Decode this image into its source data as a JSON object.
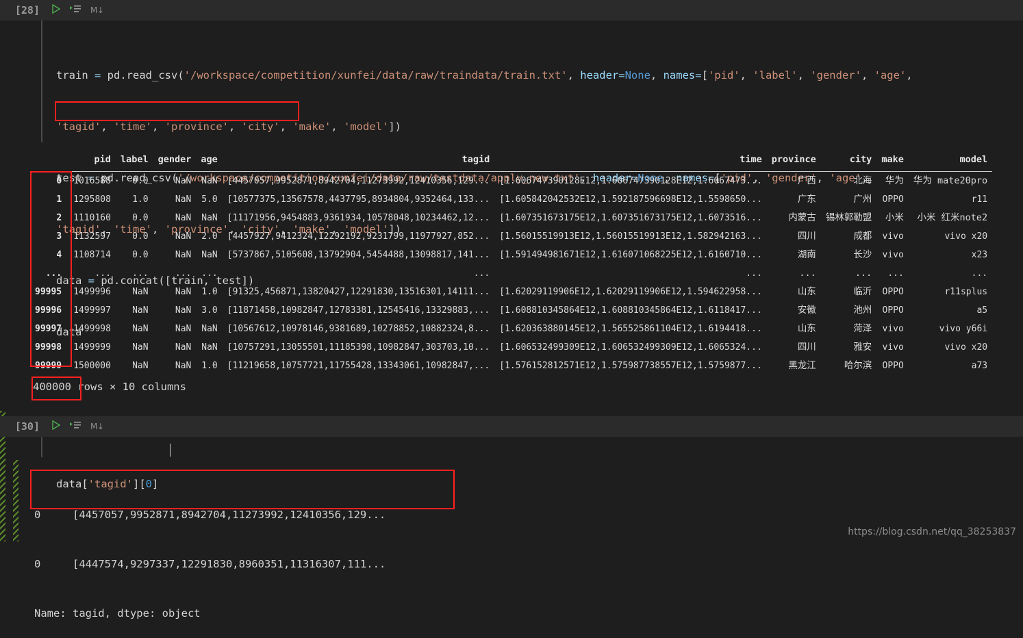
{
  "cell1": {
    "exec_count": "[28]",
    "icons": {
      "run": "play-icon",
      "run_all": "run-all-icon",
      "markdown": "M↓"
    },
    "code_lines": [
      [
        {
          "t": "train ",
          "c": "plain"
        },
        {
          "t": "= ",
          "c": "op"
        },
        {
          "t": "pd.read_csv(",
          "c": "plain"
        },
        {
          "t": "'/workspace/competition/xunfei/data/raw/traindata/train.txt'",
          "c": "str"
        },
        {
          "t": ", ",
          "c": "plain"
        },
        {
          "t": "header",
          "c": "param"
        },
        {
          "t": "=",
          "c": "op"
        },
        {
          "t": "None",
          "c": "kw"
        },
        {
          "t": ", ",
          "c": "plain"
        },
        {
          "t": "names",
          "c": "param"
        },
        {
          "t": "=",
          "c": "op"
        },
        {
          "t": "[",
          "c": "plain"
        },
        {
          "t": "'pid'",
          "c": "str"
        },
        {
          "t": ", ",
          "c": "plain"
        },
        {
          "t": "'label'",
          "c": "str"
        },
        {
          "t": ", ",
          "c": "plain"
        },
        {
          "t": "'gender'",
          "c": "str"
        },
        {
          "t": ", ",
          "c": "plain"
        },
        {
          "t": "'age'",
          "c": "str"
        },
        {
          "t": ",",
          "c": "plain"
        }
      ],
      [
        {
          "t": "'tagid'",
          "c": "str"
        },
        {
          "t": ", ",
          "c": "plain"
        },
        {
          "t": "'time'",
          "c": "str"
        },
        {
          "t": ", ",
          "c": "plain"
        },
        {
          "t": "'province'",
          "c": "str"
        },
        {
          "t": ", ",
          "c": "plain"
        },
        {
          "t": "'city'",
          "c": "str"
        },
        {
          "t": ", ",
          "c": "plain"
        },
        {
          "t": "'make'",
          "c": "str"
        },
        {
          "t": ", ",
          "c": "plain"
        },
        {
          "t": "'model'",
          "c": "str"
        },
        {
          "t": "])",
          "c": "plain"
        }
      ],
      [
        {
          "t": "test ",
          "c": "plain"
        },
        {
          "t": "= ",
          "c": "op"
        },
        {
          "t": "pd.read_csv(",
          "c": "plain"
        },
        {
          "t": "'/workspace/competition/xunfei/data/raw/testdata/apply_new.txt'",
          "c": "str"
        },
        {
          "t": ", ",
          "c": "plain"
        },
        {
          "t": "header",
          "c": "param"
        },
        {
          "t": "=",
          "c": "op"
        },
        {
          "t": "None",
          "c": "kw"
        },
        {
          "t": ", ",
          "c": "plain"
        },
        {
          "t": "names",
          "c": "param"
        },
        {
          "t": "=",
          "c": "op"
        },
        {
          "t": "[",
          "c": "plain"
        },
        {
          "t": "'pid'",
          "c": "str"
        },
        {
          "t": ", ",
          "c": "plain"
        },
        {
          "t": "'gender'",
          "c": "str"
        },
        {
          "t": ", ",
          "c": "plain"
        },
        {
          "t": "'age'",
          "c": "str"
        },
        {
          "t": ",",
          "c": "plain"
        }
      ],
      [
        {
          "t": "'tagid'",
          "c": "str"
        },
        {
          "t": ", ",
          "c": "plain"
        },
        {
          "t": "'time'",
          "c": "str"
        },
        {
          "t": ", ",
          "c": "plain"
        },
        {
          "t": "'province'",
          "c": "str"
        },
        {
          "t": ", ",
          "c": "plain"
        },
        {
          "t": "'city'",
          "c": "str"
        },
        {
          "t": ", ",
          "c": "plain"
        },
        {
          "t": "'make'",
          "c": "str"
        },
        {
          "t": ", ",
          "c": "plain"
        },
        {
          "t": "'model'",
          "c": "str"
        },
        {
          "t": "])",
          "c": "plain"
        }
      ],
      [
        {
          "t": "data ",
          "c": "plain"
        },
        {
          "t": "= ",
          "c": "op"
        },
        {
          "t": "pd.concat([train, test])",
          "c": "plain"
        }
      ],
      [
        {
          "t": "data",
          "c": "plain"
        }
      ]
    ]
  },
  "dataframe": {
    "columns": [
      "pid",
      "label",
      "gender",
      "age",
      "tagid",
      "time",
      "province",
      "city",
      "make",
      "model"
    ],
    "index_header": "",
    "rows": [
      {
        "index": "0",
        "pid": "1016588",
        "label": "0.0",
        "gender": "NaN",
        "age": "NaN",
        "tagid": "[4457057,9952871,8942704,11273992,12410356,129...",
        "time": "[1.606747390128E12,1.606747390128E12,1.6067473...",
        "province": "广西",
        "city": "北海",
        "make": "华为",
        "model": "华为 mate20pro"
      },
      {
        "index": "1",
        "pid": "1295808",
        "label": "1.0",
        "gender": "NaN",
        "age": "5.0",
        "tagid": "[10577375,13567578,4437795,8934804,9352464,133...",
        "time": "[1.605842042532E12,1.592187596698E12,1.5598650...",
        "province": "广东",
        "city": "广州",
        "make": "OPPO",
        "model": "r11"
      },
      {
        "index": "2",
        "pid": "1110160",
        "label": "0.0",
        "gender": "NaN",
        "age": "NaN",
        "tagid": "[11171956,9454883,9361934,10578048,10234462,12...",
        "time": "[1.607351673175E12,1.607351673175E12,1.6073516...",
        "province": "内蒙古",
        "city": "锡林郭勒盟",
        "make": "小米",
        "model": "小米 红米note2"
      },
      {
        "index": "3",
        "pid": "1132597",
        "label": "0.0",
        "gender": "NaN",
        "age": "2.0",
        "tagid": "[4457927,9412324,12292192,9231799,11977927,852...",
        "time": "[1.56015519913E12,1.56015519913E12,1.582942163...",
        "province": "四川",
        "city": "成都",
        "make": "vivo",
        "model": "vivo x20"
      },
      {
        "index": "4",
        "pid": "1108714",
        "label": "0.0",
        "gender": "NaN",
        "age": "NaN",
        "tagid": "[5737867,5105608,13792904,5454488,13098817,141...",
        "time": "[1.591494981671E12,1.616071068225E12,1.6160710...",
        "province": "湖南",
        "city": "长沙",
        "make": "vivo",
        "model": "x23"
      },
      {
        "index": "...",
        "pid": "...",
        "label": "...",
        "gender": "...",
        "age": "...",
        "tagid": "...",
        "time": "...",
        "province": "...",
        "city": "...",
        "make": "...",
        "model": "..."
      },
      {
        "index": "99995",
        "pid": "1499996",
        "label": "NaN",
        "gender": "NaN",
        "age": "1.0",
        "tagid": "[91325,456871,13820427,12291830,13516301,14111...",
        "time": "[1.62029119906E12,1.62029119906E12,1.594622958...",
        "province": "山东",
        "city": "临沂",
        "make": "OPPO",
        "model": "r11splus"
      },
      {
        "index": "99996",
        "pid": "1499997",
        "label": "NaN",
        "gender": "NaN",
        "age": "3.0",
        "tagid": "[11871458,10982847,12783381,12545416,13329883,...",
        "time": "[1.608810345864E12,1.608810345864E12,1.6118417...",
        "province": "安徽",
        "city": "池州",
        "make": "OPPO",
        "model": "a5"
      },
      {
        "index": "99997",
        "pid": "1499998",
        "label": "NaN",
        "gender": "NaN",
        "age": "NaN",
        "tagid": "[10567612,10978146,9381689,10278852,10882324,8...",
        "time": "[1.620363880145E12,1.565525861104E12,1.6194418...",
        "province": "山东",
        "city": "菏泽",
        "make": "vivo",
        "model": "vivo y66i"
      },
      {
        "index": "99998",
        "pid": "1499999",
        "label": "NaN",
        "gender": "NaN",
        "age": "NaN",
        "tagid": "[10757291,13055501,11185398,10982847,303703,10...",
        "time": "[1.606532499309E12,1.606532499309E12,1.6065324...",
        "province": "四川",
        "city": "雅安",
        "make": "vivo",
        "model": "vivo x20"
      },
      {
        "index": "99999",
        "pid": "1500000",
        "label": "NaN",
        "gender": "NaN",
        "age": "1.0",
        "tagid": "[11219658,10757721,11755428,13343061,10982847,...",
        "time": "[1.576152812571E12,1.575987738557E12,1.5759877...",
        "province": "黑龙江",
        "city": "哈尔滨",
        "make": "OPPO",
        "model": "a73"
      }
    ],
    "shape_count": "400000",
    "shape_suffix": " rows × 10 columns"
  },
  "cell2": {
    "exec_count": "[30]",
    "icons": {
      "run": "play-icon",
      "run_all": "run-all-icon",
      "markdown": "M↓"
    },
    "code_lines": [
      [
        {
          "t": "data[",
          "c": "plain"
        },
        {
          "t": "'tagid'",
          "c": "str"
        },
        {
          "t": "][",
          "c": "plain"
        },
        {
          "t": "0",
          "c": "num"
        },
        {
          "t": "]",
          "c": "plain"
        }
      ]
    ]
  },
  "output2": {
    "lines": [
      "0     [4457057,9952871,8942704,11273992,12410356,129...",
      "0     [4447574,9297337,12291830,8960351,11316307,111..."
    ],
    "footer": "Name: tagid, dtype: object"
  },
  "annotations": {
    "box_concat": "highlight-concat-line",
    "box_index": "highlight-index-column",
    "box_rowcount": "highlight-row-count",
    "box_output": "highlight-series-output",
    "color": "#ff2020"
  },
  "watermark": "https://blog.csdn.net/qq_38253837"
}
